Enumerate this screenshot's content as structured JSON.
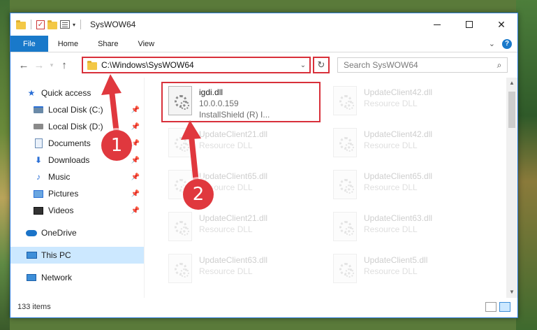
{
  "window": {
    "title": "SysWOW64",
    "minimize": "—",
    "maximize": "",
    "close": "✕"
  },
  "ribbon": {
    "tabs": [
      {
        "label": "File"
      },
      {
        "label": "Home"
      },
      {
        "label": "Share"
      },
      {
        "label": "View"
      }
    ],
    "expand": "⌄",
    "help": "?"
  },
  "address": {
    "path": "C:\\Windows\\SysWOW64",
    "search_placeholder": "Search SysWOW64"
  },
  "sidebar": {
    "items": [
      {
        "label": "Quick access",
        "icon": "star-icon"
      },
      {
        "label": "Local Disk (C:)",
        "icon": "disk-icon",
        "pinned": true
      },
      {
        "label": "Local Disk (D:)",
        "icon": "disk-icon",
        "pinned": true
      },
      {
        "label": "Documents",
        "icon": "documents-icon",
        "pinned": true
      },
      {
        "label": "Downloads",
        "icon": "downloads-icon",
        "pinned": true
      },
      {
        "label": "Music",
        "icon": "music-icon",
        "pinned": true
      },
      {
        "label": "Pictures",
        "icon": "pictures-icon",
        "pinned": true
      },
      {
        "label": "Videos",
        "icon": "videos-icon",
        "pinned": true
      },
      {
        "label": "OneDrive",
        "icon": "onedrive-icon"
      },
      {
        "label": "This PC",
        "icon": "pc-icon",
        "selected": true
      },
      {
        "label": "Network",
        "icon": "network-icon"
      }
    ]
  },
  "files": [
    {
      "name": "igdi.dll",
      "line2": "10.0.0.159",
      "line3": "InstallShield (R) I..."
    },
    {
      "name": "UpdateClient42.dll",
      "line2": "Resource DLL"
    },
    {
      "name": "UpdateClient21.dll",
      "line2": "Resource DLL"
    },
    {
      "name": "UpdateClient42.dll",
      "line2": "Resource DLL"
    },
    {
      "name": "UpdateClient65.dll",
      "line2": "Resource DLL"
    },
    {
      "name": "UpdateClient65.dll",
      "line2": "Resource DLL"
    },
    {
      "name": "UpdateClient21.dll",
      "line2": "Resource DLL"
    },
    {
      "name": "UpdateClient63.dll",
      "line2": "Resource DLL"
    },
    {
      "name": "UpdateClient63.dll",
      "line2": "Resource DLL"
    },
    {
      "name": "UpdateClient5.dll",
      "line2": "Resource DLL"
    }
  ],
  "status": {
    "item_count": "133 items"
  },
  "callouts": {
    "one": "1",
    "two": "2"
  },
  "colors": {
    "accent": "#1979ca",
    "highlight_red": "#d8303a",
    "callout_red": "#e0383e",
    "selected_bg": "#cce8ff"
  }
}
